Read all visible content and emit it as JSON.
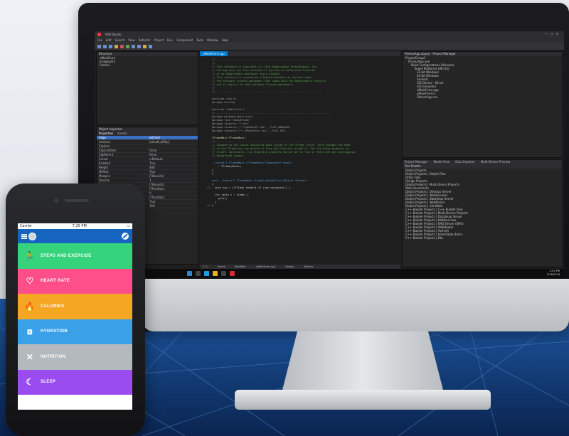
{
  "ide": {
    "title": "RAD Studio",
    "menu": [
      "File",
      "Edit",
      "Search",
      "View",
      "Refactor",
      "Project",
      "Run",
      "Component",
      "Tools",
      "Window",
      "Help"
    ],
    "editor_tab": "uMainForm.cpp",
    "structure_title": "Structure",
    "structure_items": [
      "uMainForm",
      "ImageList1",
      "Frame1"
    ],
    "inspector_title": "Object Inspector",
    "inspector_tabs": [
      "Properties",
      "Events"
    ],
    "inspector_rows": [
      [
        "Align",
        "alClient"
      ],
      [
        "Anchors",
        "[akLeft,akTop]"
      ],
      [
        "Caption",
        ""
      ],
      [
        "ClipChildren",
        "False"
      ],
      [
        "ClipParent",
        "False"
      ],
      [
        "Cursor",
        "crDefault"
      ],
      [
        "Enabled",
        "True"
      ],
      [
        "Height",
        "480"
      ],
      [
        "HitTest",
        "True"
      ],
      [
        "Margins",
        "(TBounds)"
      ],
      [
        "Opacity",
        "1"
      ],
      [
        "Padding",
        "(TBounds)"
      ],
      [
        "Position",
        "(TPosition)"
      ],
      [
        "RotationAngle",
        "0"
      ],
      [
        "Scale",
        "(TPosition)"
      ],
      [
        "Visible",
        "True"
      ],
      [
        "Width",
        "320"
      ]
    ],
    "project_title": "FitnessApp.cbproj - Project Manager",
    "project_items": [
      "ProjectGroup1",
      "FitnessApp.exe",
      "Build Configurations (Release)",
      "Target Platforms (Win32)",
      "32-bit Windows",
      "64-bit Windows",
      "Android",
      "iOS Device - 64 bit",
      "iOS Simulator",
      "uMainForm.cpp",
      "uMainForm.h",
      "FitnessApp.res"
    ],
    "tool_palette_title": "Tool Palette",
    "palette_tabs": [
      "Project Manager",
      "Model View",
      "Data Explorer",
      "Multi-Device Preview"
    ],
    "palette_items": [
      "Delphi Projects",
      "Delphi Projects | Delphi Files",
      "Other Files",
      "Design Projects",
      "Delphi Projects | Multi-Device Projects",
      "Web Documents",
      "Delphi Projects | Desktop Server",
      "Delphi Projects | WebServices",
      "Delphi Projects | DataSnap Server",
      "Delphi Projects | WebBroker",
      "Delphi Projects | IntraWeb",
      "C++ Builder Projects | C++ Builder Files",
      "C++ Builder Projects | Multi-Device Projects",
      "C++ Builder Projects | DataSnap Server",
      "C++ Builder Projects | WebServices",
      "C++ Builder Projects | RAD Server (EMS)",
      "C++ Builder Projects | WebBroker",
      "C++ Builder Projects | ActiveX",
      "C++ Builder Projects | Inheritable Items",
      "C++ Builder Projects | DLL"
    ],
    "status": [
      "1: 1",
      "Insert",
      "Modified",
      "uMainForm.cpp",
      "Design",
      "History"
    ],
    "clock_time": "2:51 PM",
    "clock_date": "2/18/2016",
    "code": [
      {
        "n": "",
        "cls": "c-com",
        "t": "// ---------------------------------------------------------------------"
      },
      {
        "n": "",
        "cls": "c-com",
        "t": "//"
      },
      {
        "n": "",
        "cls": "c-com",
        "t": "// This software is Copyright (c) 2015 Embarcadero Technologies, Inc."
      },
      {
        "n": "",
        "cls": "c-com",
        "t": "// You may only use this software if you are an authorized licensee"
      },
      {
        "n": "",
        "cls": "c-com",
        "t": "// of an Embarcadero developer tools product."
      },
      {
        "n": "",
        "cls": "c-com",
        "t": "// This software is considered a Redistributable as defined under"
      },
      {
        "n": "",
        "cls": "c-com",
        "t": "// the software license agreement that comes with the Embarcadero Products"
      },
      {
        "n": "",
        "cls": "c-com",
        "t": "// and is subject to that software license agreement."
      },
      {
        "n": "",
        "cls": "c-com",
        "t": "//"
      },
      {
        "n": "",
        "cls": "c-com",
        "t": "// ---------------------------------------------------------------------"
      },
      {
        "n": "",
        "cls": "c-tx",
        "t": ""
      },
      {
        "n": "",
        "cls": "c-dir",
        "t": "#include <fmx.h>"
      },
      {
        "n": "",
        "cls": "c-dir",
        "t": "#pragma hdrstop"
      },
      {
        "n": "",
        "cls": "c-tx",
        "t": ""
      },
      {
        "n": "",
        "cls": "c-dir",
        "t": "#include \"uMainForm.h\""
      },
      {
        "n": "",
        "cls": "c-com",
        "t": "//---------------------------------------------------------------------------"
      },
      {
        "n": "",
        "cls": "c-dir",
        "t": "#pragma package(smart_init)"
      },
      {
        "n": "",
        "cls": "c-dir",
        "t": "#pragma link \"uBaseFrame\""
      },
      {
        "n": "",
        "cls": "c-dir",
        "t": "#pragma resource \"*.fmx\""
      },
      {
        "n": "",
        "cls": "c-dir",
        "t": "#pragma resource (\"*.LgXhdpiPh.fmx\", _PLAT_ANDROID)"
      },
      {
        "n": "",
        "cls": "c-dir",
        "t": "#pragma resource (\"*.iPhone55in.fmx\", _PLAT_IOS)"
      },
      {
        "n": "",
        "cls": "c-tx",
        "t": ""
      },
      {
        "n": "",
        "cls": "c-id",
        "t": "TFrameMain *FrameMain;"
      },
      {
        "n": "",
        "cls": "c-com",
        "t": "//---------------------------------------------------------------------------"
      },
      {
        "n": "",
        "cls": "c-com",
        "t": "// Changes to the layout should be made inside of the TFrame itself. Once changes are made"
      },
      {
        "n": "",
        "cls": "c-com",
        "t": "// to the TFrame you can delete it from the Form and re-add it. Set its Align property to"
      },
      {
        "n": "",
        "cls": "c-com",
        "t": "// Client. Optionally, its TCapTitle property can be set to True if there are any overlapping"
      },
      {
        "n": "",
        "cls": "c-com",
        "t": "// background images."
      },
      {
        "n": "",
        "cls": "c-tx",
        "t": ""
      },
      {
        "n": "",
        "cls": "c-kw",
        "t": "__fastcall TFrameMain::TFrameMain(TComponent* Owner)"
      },
      {
        "n": "",
        "cls": "c-tx",
        "t": "    : TFrame(Owner)"
      },
      {
        "n": "",
        "cls": "c-tx",
        "t": "{"
      },
      {
        "n": "",
        "cls": "c-tx",
        "t": "}"
      },
      {
        "n": "",
        "cls": "c-tx",
        "t": ""
      },
      {
        "n": "",
        "cls": "c-kw",
        "t": "void __fastcall TFrameMain::ItemGridItemClick(TObject *Sender)"
      },
      {
        "n": "",
        "cls": "c-tx",
        "t": "{"
      },
      {
        "n": "41",
        "cls": "c-tx",
        "t": "  auto nav = {(TItem) sender} if (nav.navigate()) {"
      },
      {
        "n": "",
        "cls": "c-tx",
        "t": ""
      },
      {
        "n": "",
        "cls": "c-tx",
        "t": "  for (auto x : items) {"
      },
      {
        "n": "",
        "cls": "c-tx",
        "t": "    go(x);"
      },
      {
        "n": "",
        "cls": "c-tx",
        "t": "  }"
      },
      {
        "n": "45",
        "cls": "c-tx",
        "t": "}"
      }
    ]
  },
  "phone": {
    "carrier": "Carrier",
    "time": "7:25 PM",
    "tiles": [
      {
        "label": "STEPS AND EXERCISE",
        "color": "#35d37b",
        "icon": "runner-icon",
        "glyph": "🏃"
      },
      {
        "label": "HEART RATE",
        "color": "#ff4f8b",
        "icon": "heart-icon",
        "glyph": "♡"
      },
      {
        "label": "CALORIES",
        "color": "#f5a623",
        "icon": "flame-icon",
        "glyph": "🔥"
      },
      {
        "label": "HYDRATION",
        "color": "#3aa0e8",
        "icon": "glass-icon",
        "glyph": "⧈"
      },
      {
        "label": "NUTRITION",
        "color": "#b4b9bd",
        "icon": "utensils-icon",
        "glyph": "✕"
      },
      {
        "label": "SLEEP",
        "color": "#9b4cf0",
        "icon": "moon-icon",
        "glyph": "☾"
      }
    ]
  }
}
